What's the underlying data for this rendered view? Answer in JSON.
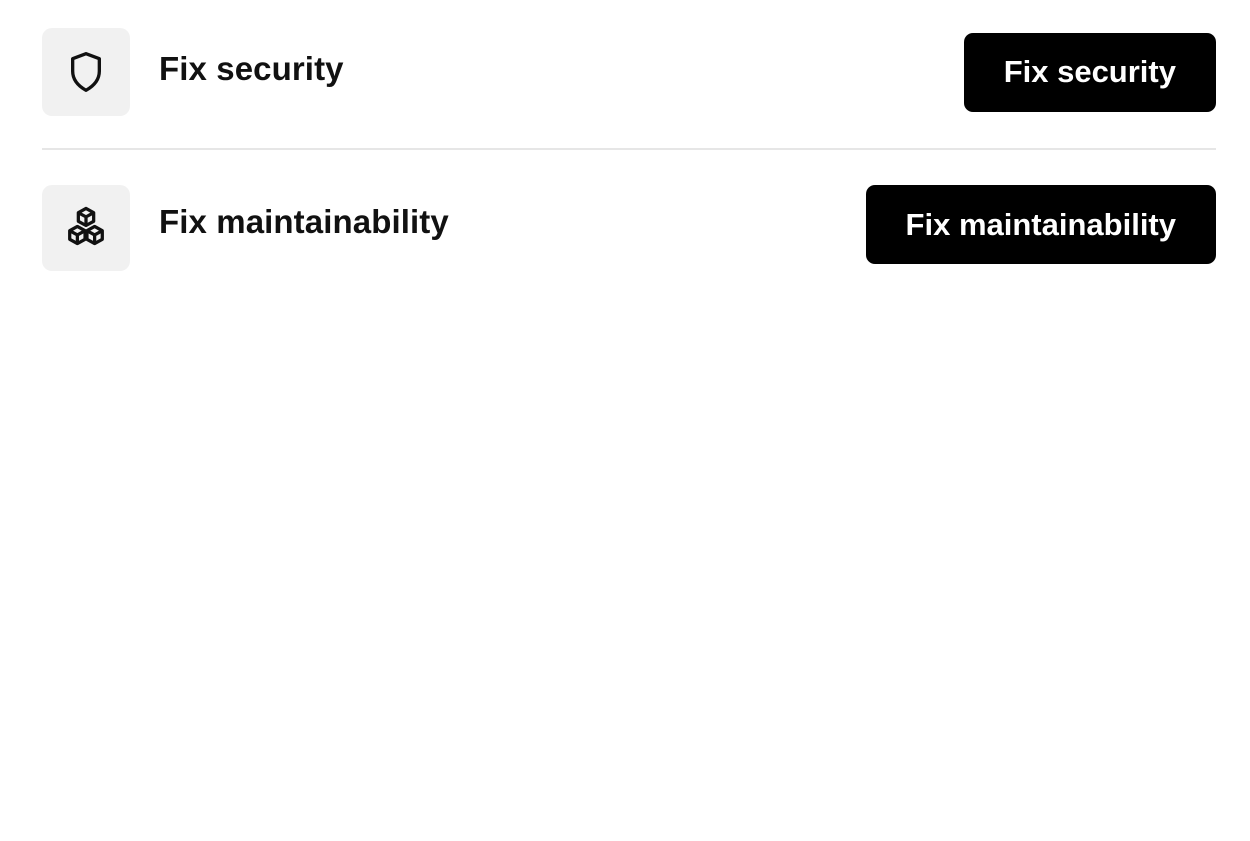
{
  "items": [
    {
      "icon": "shield-icon",
      "title": "Fix security",
      "button_label": "Fix security"
    },
    {
      "icon": "cubes-icon",
      "title": "Fix maintainability",
      "button_label": "Fix maintainability"
    }
  ],
  "colors": {
    "button_bg": "#000000",
    "button_text": "#ffffff",
    "icon_bg": "#f1f1f1",
    "divider": "#e6e6e6"
  }
}
